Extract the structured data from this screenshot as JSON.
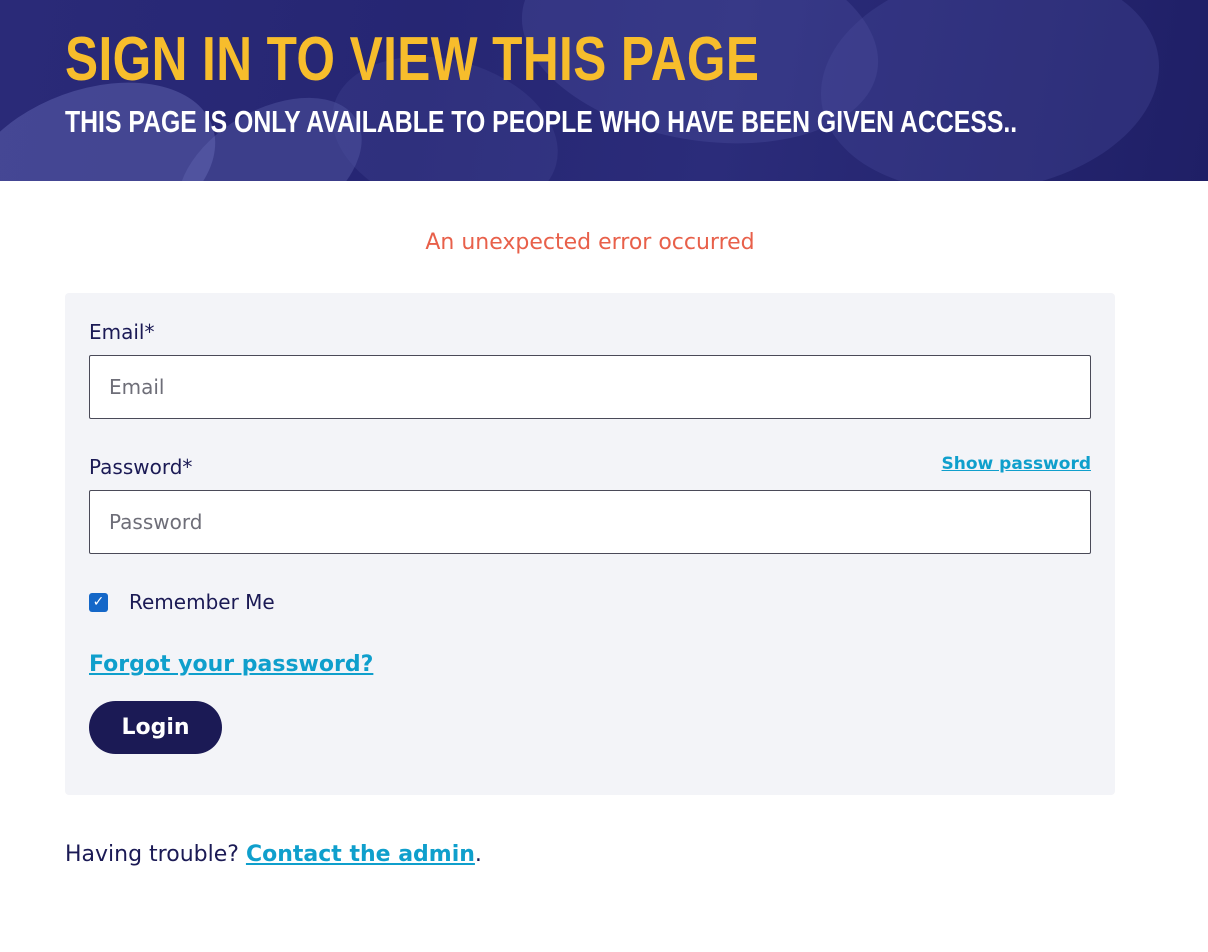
{
  "hero": {
    "title": "SIGN IN TO VIEW THIS PAGE",
    "subtitle": "THIS PAGE IS ONLY AVAILABLE TO PEOPLE WHO HAVE BEEN GIVEN ACCESS.."
  },
  "error": {
    "message": "An unexpected error occurred"
  },
  "form": {
    "email_label": "Email*",
    "email_placeholder": "Email",
    "email_value": "",
    "password_label": "Password*",
    "password_placeholder": "Password",
    "password_value": "",
    "show_password": "Show password",
    "remember_label": "Remember Me",
    "remember_checked": true,
    "checkmark": "✓",
    "forgot_link": "Forgot your password?",
    "login_label": "Login"
  },
  "footer": {
    "trouble_text": "Having trouble? ",
    "contact_link": "Contact the admin",
    "period": "."
  },
  "colors": {
    "title_accent": "#f7bd2c",
    "hero_bg": "#262673",
    "error": "#e8604a",
    "link": "#0f9fcc",
    "primary": "#1b1a55",
    "card_bg": "#f3f4f8"
  },
  "icons": {
    "remember_checkbox": "checkbox-checked-icon"
  }
}
